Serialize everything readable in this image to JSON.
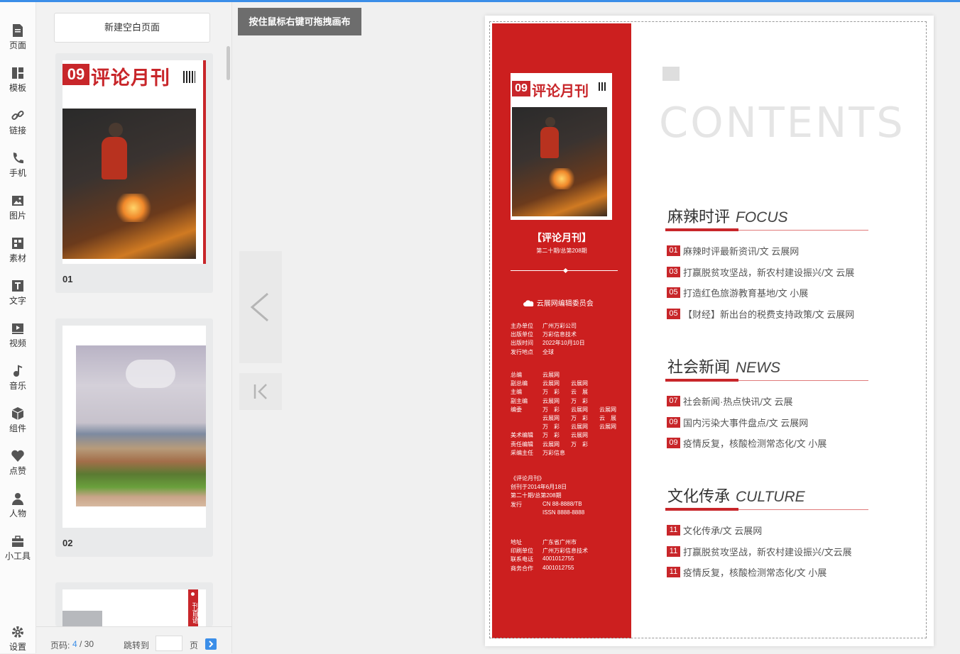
{
  "toolbar": {
    "items": [
      {
        "label": "页面",
        "icon": "page-icon"
      },
      {
        "label": "模板",
        "icon": "template-icon"
      },
      {
        "label": "链接",
        "icon": "link-icon"
      },
      {
        "label": "手机",
        "icon": "phone-icon"
      },
      {
        "label": "图片",
        "icon": "image-icon"
      },
      {
        "label": "素材",
        "icon": "material-icon"
      },
      {
        "label": "文字",
        "icon": "text-icon"
      },
      {
        "label": "视频",
        "icon": "video-icon"
      },
      {
        "label": "音乐",
        "icon": "music-icon"
      },
      {
        "label": "组件",
        "icon": "component-icon"
      },
      {
        "label": "点赞",
        "icon": "heart-icon"
      },
      {
        "label": "人物",
        "icon": "person-icon"
      },
      {
        "label": "小工具",
        "icon": "toolbox-icon"
      }
    ],
    "settings_label": "设置"
  },
  "pages_panel": {
    "new_page_label": "新建空白页面",
    "thumbs": [
      {
        "num": "01",
        "magazine_no": "09",
        "magazine_title": "评论月刊"
      },
      {
        "num": "02"
      },
      {
        "num": "",
        "side_text": "刊首语"
      }
    ],
    "page_label": "页码:",
    "current_page": "4",
    "total_pages": "/ 30",
    "jump_label": "跳转到",
    "page_unit": "页"
  },
  "canvas": {
    "hint": "按住鼠标右键可拖拽画布"
  },
  "left_page": {
    "cover_no": "09",
    "cover_title": "评论月刊",
    "title": "【评论月刊】",
    "issue": "第二十期/总第208期",
    "committee": "云展网编辑委员会",
    "info_rows": [
      {
        "k": "主办单位",
        "v": "广州万彩公司"
      },
      {
        "k": "出版单位",
        "v": "万彩信息技术"
      },
      {
        "k": "出版时间",
        "v": "2022年10月10日"
      },
      {
        "k": "发行地点",
        "v": "全球"
      }
    ],
    "staff_rows": [
      {
        "k": "总编",
        "v": "云展网"
      },
      {
        "k": "副总编",
        "v": "云展网　　云展网"
      },
      {
        "k": "主编",
        "v": "万　彩　　云　展"
      },
      {
        "k": "副主编",
        "v": "云展网　　万　彩"
      },
      {
        "k": "编委",
        "v": "万　彩　　云展网　　云展网"
      },
      {
        "k": "",
        "v": "云展网　　万　彩　　云　展"
      },
      {
        "k": "",
        "v": "万　彩　　云展网　　云展网"
      },
      {
        "k": "美术编辑",
        "v": "万　彩　　云展网"
      },
      {
        "k": "责任编辑",
        "v": "云展网　　万　彩"
      },
      {
        "k": "采编主任",
        "v": "万彩信息"
      }
    ],
    "pub_rows": [
      {
        "k": "《评论月刊》",
        "v": ""
      },
      {
        "k": "创刊于2014年6月18日",
        "v": ""
      },
      {
        "k": "第二十期/总第208期",
        "v": ""
      },
      {
        "k": "发行",
        "v": "CN 88-8888/TB"
      },
      {
        "k": "",
        "v": "ISSN 8888-8888"
      }
    ],
    "contact_rows": [
      {
        "k": "地址",
        "v": "广东省广州市"
      },
      {
        "k": "印刷单位",
        "v": "广州万彩信息技术"
      },
      {
        "k": "联系电话",
        "v": "4001012755"
      },
      {
        "k": "商务合作",
        "v": "4001012755"
      }
    ]
  },
  "right_page": {
    "heading": "CONTENTS",
    "sections": [
      {
        "title": "麻辣时评",
        "en": "FOCUS",
        "items": [
          {
            "n": "01",
            "t": "麻辣时评最新资讯/文 云展网"
          },
          {
            "n": "03",
            "t": "打赢脱贫攻坚战，新农村建设振兴/文 云展"
          },
          {
            "n": "05",
            "t": "打造红色旅游教育基地/文 小展"
          },
          {
            "n": "05",
            "t": "【财经】新出台的税费支持政策/文 云展网"
          }
        ]
      },
      {
        "title": "社会新闻",
        "en": "NEWS",
        "items": [
          {
            "n": "07",
            "t": "社会新闻·热点快讯/文 云展"
          },
          {
            "n": "09",
            "t": "国内污染大事件盘点/文 云展网"
          },
          {
            "n": "09",
            "t": "疫情反复，核酸检测常态化/文 小展"
          }
        ]
      },
      {
        "title": "文化传承",
        "en": "CULTURE",
        "items": [
          {
            "n": "11",
            "t": "文化传承/文 云展网"
          },
          {
            "n": "11",
            "t": "打赢脱贫攻坚战，新农村建设振兴/文云展"
          },
          {
            "n": "11",
            "t": "疫情反复，核酸检测常态化/文 小展"
          }
        ]
      }
    ]
  },
  "colors": {
    "accent": "#c8262a",
    "page_red": "#cc1f1f",
    "link_blue": "#3b8ee8"
  }
}
